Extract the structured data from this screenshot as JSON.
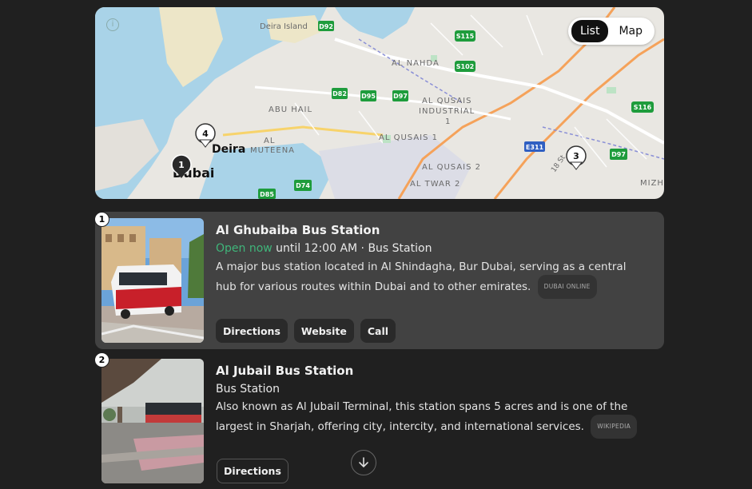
{
  "map": {
    "view_toggle": {
      "list_label": "List",
      "map_label": "Map",
      "active": "List"
    },
    "info_icon": "ⓘ",
    "labels": {
      "deira_island": "Deira Island",
      "al_nahda": "AL NAHDA",
      "al_qusais_industrial": "AL QUSAIS",
      "industrial": "INDUSTRIAL",
      "industrial_num": "1",
      "abu_hail": "ABU HAIL",
      "al": "AL",
      "muteena": "MUTEENA",
      "al_qusais_1": "AL QUSAIS 1",
      "deira": "Deira",
      "dubai": "Dubai",
      "al_qusais_2": "AL QUSAIS 2",
      "al_twar_2": "AL TWAR 2",
      "mizh": "MIZH",
      "st": "18 St"
    },
    "road_shields": [
      "D92",
      "S115",
      "S102",
      "D82",
      "D95",
      "D97",
      "S116",
      "E311",
      "D97",
      "D85",
      "D74"
    ],
    "markers": [
      "1",
      "4",
      "3"
    ]
  },
  "results": [
    {
      "number": "1",
      "name": "Al Ghubaiba Bus Station",
      "status": "Open now",
      "hours": " until 12:00 AM · Bus Station",
      "description": "A major bus station located in Al Shindagha, Bur Dubai, serving as a central hub for various routes within Dubai and to other emirates.",
      "source": "DUBAI ONLINE",
      "buttons": [
        "Directions",
        "Website",
        "Call"
      ]
    },
    {
      "number": "2",
      "name": "Al Jubail Bus Station",
      "category": "Bus Station",
      "description": "Also known as Al Jubail Terminal, this station spans 5 acres and is one of the largest in Sharjah, offering city, intercity, and international services.",
      "source": "WIKIPEDIA",
      "buttons": [
        "Directions"
      ]
    }
  ],
  "colors": {
    "open_green": "#3fb57a",
    "card_bg": "#424242",
    "page_bg": "#202020"
  }
}
